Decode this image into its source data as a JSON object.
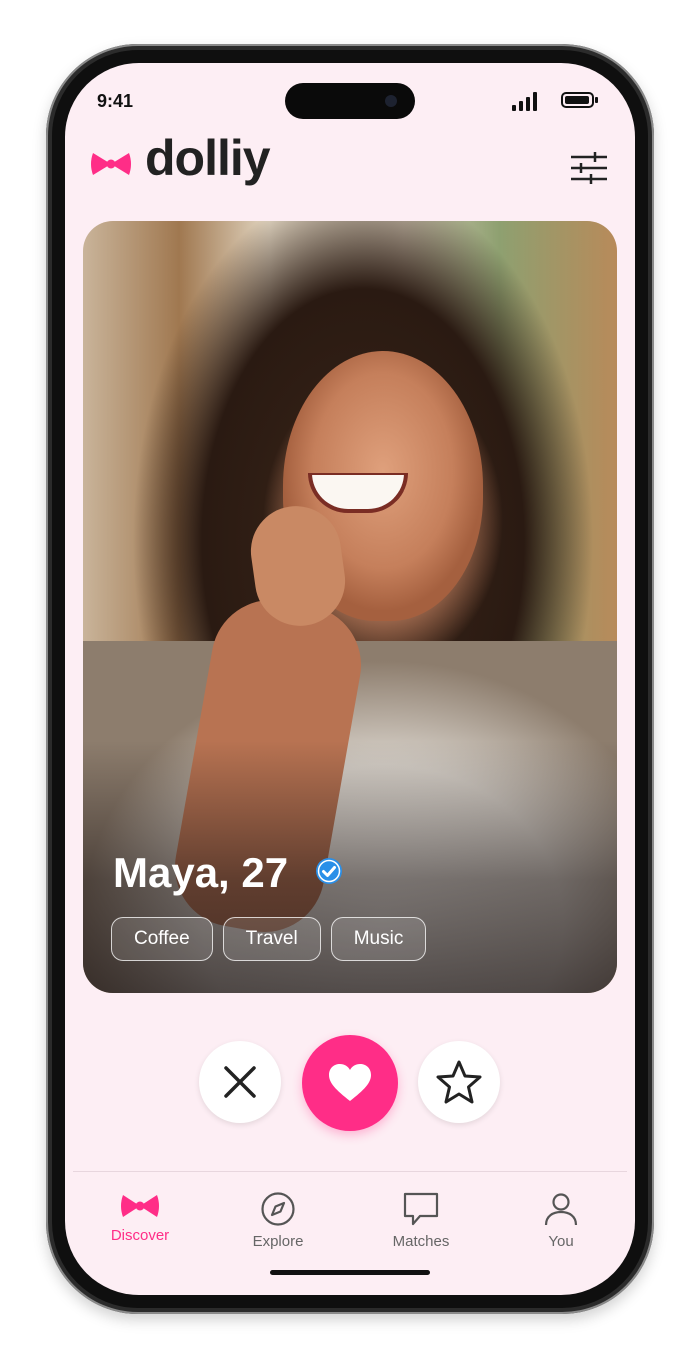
{
  "status_bar": {
    "time": "9:41"
  },
  "app": {
    "brand": "dolliy",
    "accent_color": "#ff2d87"
  },
  "header": {
    "filter_icon": "sliders-icon"
  },
  "profile": {
    "name_age": "Maya, 27",
    "verified": true,
    "tags": [
      "Coffee",
      "Travel",
      "Music"
    ]
  },
  "actions": [
    {
      "name": "nope",
      "icon": "close-icon"
    },
    {
      "name": "like",
      "icon": "heart-icon"
    },
    {
      "name": "super-like",
      "icon": "star-icon"
    }
  ],
  "tabs": [
    {
      "label": "Discover",
      "icon": "bow-icon",
      "active": true
    },
    {
      "label": "Explore",
      "icon": "compass-icon",
      "active": false
    },
    {
      "label": "Matches",
      "icon": "chat-bubble-icon",
      "active": false
    },
    {
      "label": "You",
      "icon": "person-icon",
      "active": false
    }
  ]
}
